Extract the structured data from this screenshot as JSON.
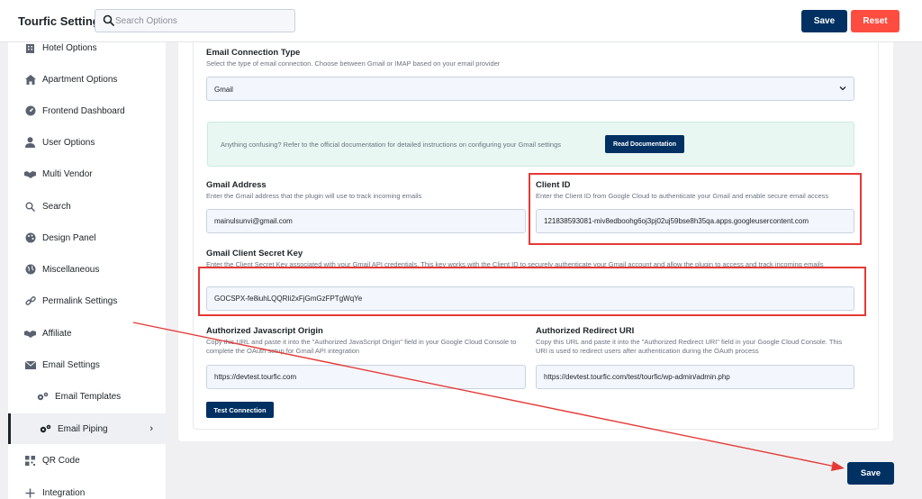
{
  "header": {
    "title": "Tourfic Settings",
    "search_placeholder": "Search Options",
    "save_label": "Save",
    "reset_label": "Reset"
  },
  "sidebar": {
    "items": [
      {
        "label": "Hotel Options",
        "icon": "hotel-icon"
      },
      {
        "label": "Apartment Options",
        "icon": "home-icon"
      },
      {
        "label": "Frontend Dashboard",
        "icon": "dashboard-icon"
      },
      {
        "label": "User Options",
        "icon": "user-icon"
      },
      {
        "label": "Multi Vendor",
        "icon": "handshake-icon"
      },
      {
        "label": "Search",
        "icon": "search-icon"
      },
      {
        "label": "Design Panel",
        "icon": "palette-icon"
      },
      {
        "label": "Miscellaneous",
        "icon": "globe-icon"
      },
      {
        "label": "Permalink Settings",
        "icon": "link-icon"
      },
      {
        "label": "Affiliate",
        "icon": "handshake-icon"
      },
      {
        "label": "Email Settings",
        "icon": "envelope-icon"
      },
      {
        "label": "Email Templates",
        "icon": "gears-icon"
      },
      {
        "label": "Email Piping",
        "icon": "gears-icon"
      },
      {
        "label": "QR Code",
        "icon": "qrcode-icon"
      },
      {
        "label": "Integration",
        "icon": "plus-icon"
      }
    ]
  },
  "form": {
    "connection_type": {
      "title": "Email Connection Type",
      "desc": "Select the type of email connection. Choose between Gmail or IMAP based on your email provider",
      "value": "Gmail"
    },
    "notice": {
      "text": "Anything confusing? Refer to the official documentation for detailed instructions on configuring your Gmail settings",
      "button": "Read Documentation"
    },
    "gmail_address": {
      "title": "Gmail Address",
      "desc": "Enter the Gmail address that the plugin will use to track incoming emails",
      "value": "mainulsunvi@gmail.com"
    },
    "client_id": {
      "title": "Client ID",
      "desc": "Enter the Client ID from Google Cloud to authenticate your Gmail and enable secure email access",
      "value": "121838593081-miv8edboohg6oj3pj02uj59bse8h35qa.apps.googleusercontent.com"
    },
    "client_secret": {
      "title": "Gmail Client Secret Key",
      "desc": "Enter the Client Secret Key associated with your Gmail API credentials. This key works with the Client ID to securely authenticate your Gmail account and allow the plugin to access and track incoming emails",
      "value": "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"
    },
    "js_origin": {
      "title": "Authorized Javascript Origin",
      "desc": "Copy this URL and paste it into the \"Authorized JavaScript Origin\" field in your Google Cloud Console to complete the OAuth setup for Gmail API integration",
      "value": "https://devtest.tourfic.com"
    },
    "redirect_uri": {
      "title": "Authorized Redirect URI",
      "desc": "Copy this URL and paste it into the \"Authorized Redirect URI\" field in your Google Cloud Console. This URI is used to redirect users after authentication during the OAuth process",
      "value": "https://devtest.tourfic.com/test/tourfic/wp-admin/admin.php"
    },
    "test_button": "Test Connection"
  },
  "footer": {
    "save_label": "Save"
  },
  "colors": {
    "primary": "#003162",
    "danger": "#fd4d40",
    "highlight": "#e53935"
  }
}
